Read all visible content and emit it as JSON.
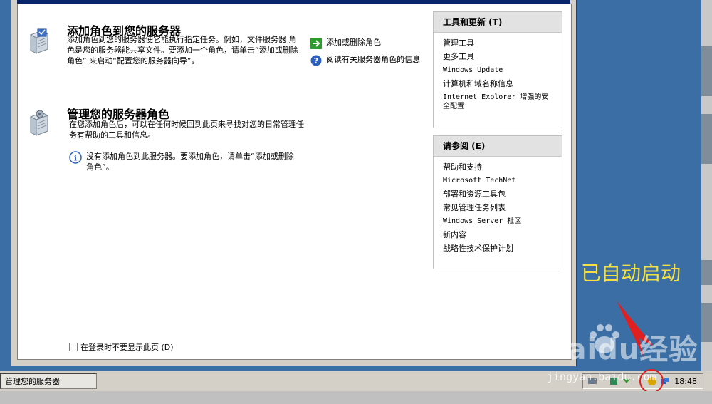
{
  "add_role": {
    "title": "添加角色到您的服务器",
    "description": "添加角色到您的服务器使它能执行指定任务。例如，文件服务器 角色是您的服务器能共享文件。要添加一个角色，请单击“添加或删除角色” 来启动“配置您的服务器向导”。",
    "actions": [
      {
        "label": "添加或删除角色",
        "icon": "green-arrow-icon"
      },
      {
        "label": "阅读有关服务器角色的信息",
        "icon": "help-icon"
      }
    ]
  },
  "manage_role": {
    "title": "管理您的服务器角色",
    "description": "在您添加角色后，可以在任何时候回到此页来寻找对您的日常管理任务有帮助的工具和信息。",
    "note": "没有添加角色到此服务器。要添加角色，请单击“添加或删除角色”。"
  },
  "footer": {
    "checkbox_label": "在登录时不要显示此页 (D)",
    "checked": false
  },
  "tools_panel": {
    "title": "工具和更新 (T)",
    "items": [
      "管理工具",
      "更多工具",
      "Windows Update",
      "计算机和域名称信息",
      "Internet Explorer 增强的安全配置"
    ]
  },
  "see_also_panel": {
    "title": "请参阅 (E)",
    "items": [
      "帮助和支持",
      "Microsoft TechNet",
      "部署和资源工具包",
      "常见管理任务列表",
      "Windows Server 社区",
      "新内容",
      "战略性技术保护计划"
    ]
  },
  "annotation": {
    "text": "已自动启动",
    "color": "#f4e040"
  },
  "taskbar": {
    "task_label": "管理您的服务器",
    "clock": "18:48"
  },
  "watermark": {
    "logo": "Baidu经验",
    "sub": "jingyan.baidu.com"
  }
}
